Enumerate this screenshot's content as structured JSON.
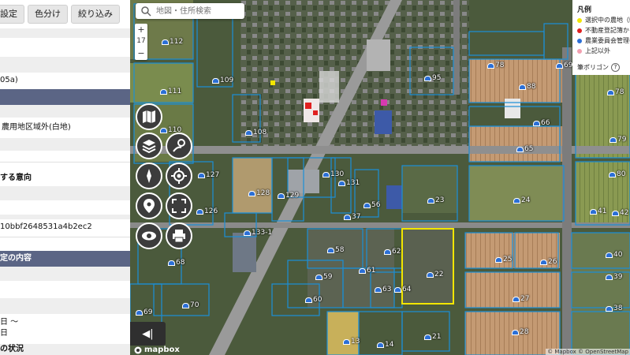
{
  "panel": {
    "buttons": [
      "示設定",
      "色分け",
      "絞り込み"
    ],
    "area_text": "05a)",
    "zone_text": "農用地区域外(白地)",
    "intent_header": "する意向",
    "id_text": "10bbf2648531a4b2ec2",
    "section_header": "定の内容",
    "date_row1": "日 〜",
    "date_row2": "日",
    "status_header": "の状況"
  },
  "map": {
    "search_placeholder": "地図・住所検索",
    "zoom_in": "+",
    "zoom_level": "17",
    "zoom_out": "−",
    "collapse_icon": "◀|",
    "mapbox_label": "mapbox",
    "attribution": "© Mapbox © OpenStreetMap",
    "parcel_labels": [
      {
        "t": "112"
      },
      {
        "t": "109"
      },
      {
        "t": "111"
      },
      {
        "t": "110"
      },
      {
        "t": "108"
      },
      {
        "t": "127"
      },
      {
        "t": "128"
      },
      {
        "t": "129"
      },
      {
        "t": "130"
      },
      {
        "t": "131"
      },
      {
        "t": "126"
      },
      {
        "t": "133-1"
      },
      {
        "t": "37"
      },
      {
        "t": "56"
      },
      {
        "t": "23"
      },
      {
        "t": "58"
      },
      {
        "t": "62"
      },
      {
        "t": "61"
      },
      {
        "t": "59"
      },
      {
        "t": "63"
      },
      {
        "t": "64"
      },
      {
        "t": "22"
      },
      {
        "t": "60"
      },
      {
        "t": "68"
      },
      {
        "t": "70"
      },
      {
        "t": "69"
      },
      {
        "t": "95"
      },
      {
        "t": "78"
      },
      {
        "t": "69"
      },
      {
        "t": "88"
      },
      {
        "t": "78"
      },
      {
        "t": "66"
      },
      {
        "t": "65"
      },
      {
        "t": "79"
      },
      {
        "t": "80"
      },
      {
        "t": "24"
      },
      {
        "t": "41"
      },
      {
        "t": "42"
      },
      {
        "t": "25"
      },
      {
        "t": "26"
      },
      {
        "t": "40"
      },
      {
        "t": "27"
      },
      {
        "t": "39"
      },
      {
        "t": "28"
      },
      {
        "t": "38"
      },
      {
        "t": "21"
      },
      {
        "t": "13"
      },
      {
        "t": "14"
      }
    ]
  },
  "legend": {
    "title": "凡例",
    "items": [
      {
        "label": "選択中の農地（輪",
        "color": "#f2e600"
      },
      {
        "label": "不動産登記簿から",
        "color": "#e02020"
      },
      {
        "label": "農業委員会管理の",
        "color": "#2b6fd6"
      },
      {
        "label": "上記以外",
        "color": "#f2a0b0"
      }
    ],
    "polygon_label": "筆ポリゴン",
    "help": "?"
  }
}
